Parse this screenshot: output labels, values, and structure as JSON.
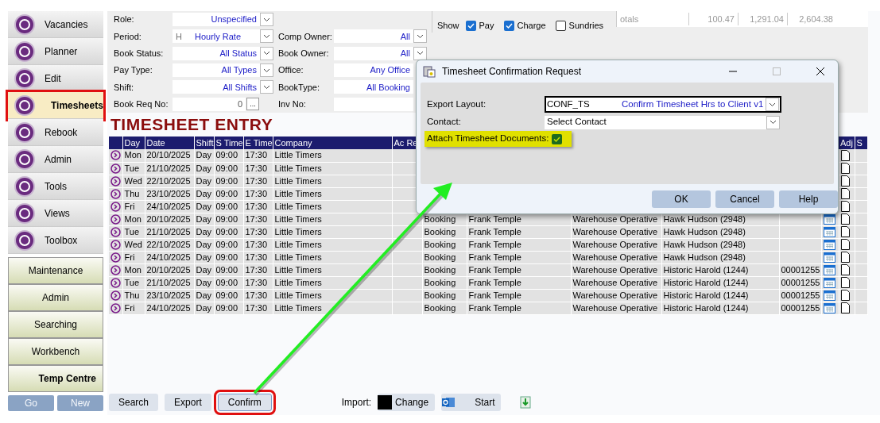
{
  "sidebar": {
    "items": [
      {
        "label": "Vacancies",
        "selected": false,
        "highlighted": false
      },
      {
        "label": "Planner",
        "selected": false,
        "highlighted": false
      },
      {
        "label": "Edit",
        "selected": false,
        "highlighted": false
      },
      {
        "label": "Timesheets",
        "selected": true,
        "highlighted": true
      },
      {
        "label": "Rebook",
        "selected": false,
        "highlighted": false
      },
      {
        "label": "Admin",
        "selected": false,
        "highlighted": false
      },
      {
        "label": "Tools",
        "selected": false,
        "highlighted": false
      },
      {
        "label": "Views",
        "selected": false,
        "highlighted": false
      },
      {
        "label": "Toolbox",
        "selected": false,
        "highlighted": false
      }
    ],
    "modules": [
      {
        "label": "Maintenance",
        "selected": false
      },
      {
        "label": "Admin",
        "selected": false
      },
      {
        "label": "Searching",
        "selected": false
      },
      {
        "label": "Workbench",
        "selected": false
      },
      {
        "label": "Temp Centre",
        "selected": true
      }
    ],
    "buttons": [
      {
        "label": "Go",
        "disabled": true
      },
      {
        "label": "New",
        "disabled": true
      }
    ]
  },
  "filters_left": [
    {
      "label": "Role:",
      "value": "Unspecified",
      "kind": "dropdown"
    },
    {
      "label": "Period:",
      "prefix": "H",
      "value": "Hourly Rate",
      "kind": "dropdown"
    },
    {
      "label": "Book Status:",
      "value": "All Status",
      "kind": "dropdown"
    },
    {
      "label": "Pay Type:",
      "value": "All Types",
      "kind": "dropdown"
    },
    {
      "label": "Shift:",
      "value": "All Shifts",
      "kind": "dropdown"
    },
    {
      "label": "Book Req No:",
      "value": "0",
      "kind": "number",
      "button": "..."
    }
  ],
  "filters_right": [
    {
      "label": "Comp Owner:",
      "value": "All",
      "kind": "dropdown"
    },
    {
      "label": "Book Owner:",
      "value": "All",
      "kind": "dropdown"
    },
    {
      "label": "Office:",
      "value": "Any Office",
      "kind": "text"
    },
    {
      "label": "BookType:",
      "value": "All Booking",
      "kind": "text"
    },
    {
      "label": "Inv No:",
      "kind": "text"
    }
  ],
  "show": {
    "label": "Show",
    "options": [
      {
        "label": "Pay",
        "checked": true
      },
      {
        "label": "Charge",
        "checked": true
      },
      {
        "label": "Sundries",
        "checked": false
      }
    ]
  },
  "totals": {
    "label": "otals",
    "values": [
      "100.47",
      "1,291.04",
      "2,604.38"
    ]
  },
  "title": "TIMESHEET ENTRY",
  "table": {
    "columns": [
      "Day",
      "Date",
      "Shift",
      "S Time",
      "E Time",
      "Company",
      "Ac Re",
      "Adj",
      "S"
    ],
    "rows": [
      {
        "day": "Mon",
        "date": "20/10/2025",
        "shift": "Day",
        "s_time": "09:00",
        "e_time": "17:30",
        "company": "Little Timers"
      },
      {
        "day": "Tue",
        "date": "21/10/2025",
        "shift": "Day",
        "s_time": "09:00",
        "e_time": "17:30",
        "company": "Little Timers"
      },
      {
        "day": "Wed",
        "date": "22/10/2025",
        "shift": "Day",
        "s_time": "09:00",
        "e_time": "17:30",
        "company": "Little Timers"
      },
      {
        "day": "Thu",
        "date": "23/10/2025",
        "shift": "Day",
        "s_time": "09:00",
        "e_time": "17:30",
        "company": "Little Timers"
      },
      {
        "day": "Fri",
        "date": "24/10/2025",
        "shift": "Day",
        "s_time": "09:00",
        "e_time": "17:30",
        "company": "Little Timers"
      },
      {
        "day": "Mon",
        "date": "20/10/2025",
        "shift": "Day",
        "s_time": "09:00",
        "e_time": "17:30",
        "company": "Little Timers",
        "type": "Booking",
        "contact": "Frank Temple",
        "role": "Warehouse Operative",
        "candidate": "Hawk Hudson (2948)"
      },
      {
        "day": "Tue",
        "date": "21/10/2025",
        "shift": "Day",
        "s_time": "09:00",
        "e_time": "17:30",
        "company": "Little Timers",
        "type": "Booking",
        "contact": "Frank Temple",
        "role": "Warehouse Operative",
        "candidate": "Hawk Hudson (2948)"
      },
      {
        "day": "Wed",
        "date": "22/10/2025",
        "shift": "Day",
        "s_time": "09:00",
        "e_time": "17:30",
        "company": "Little Timers",
        "type": "Booking",
        "contact": "Frank Temple",
        "role": "Warehouse Operative",
        "candidate": "Hawk Hudson (2948)"
      },
      {
        "day": "Fri",
        "date": "24/10/2025",
        "shift": "Day",
        "s_time": "09:00",
        "e_time": "17:30",
        "company": "Little Timers",
        "type": "Booking",
        "contact": "Frank Temple",
        "role": "Warehouse Operative",
        "candidate": "Hawk Hudson (2948)"
      },
      {
        "day": "Mon",
        "date": "20/10/2025",
        "shift": "Day",
        "s_time": "09:00",
        "e_time": "17:30",
        "company": "Little Timers",
        "type": "Booking",
        "contact": "Frank Temple",
        "role": "Warehouse Operative",
        "candidate": "Historic Harold (1244)",
        "ref": "00001255"
      },
      {
        "day": "Tue",
        "date": "21/10/2025",
        "shift": "Day",
        "s_time": "09:00",
        "e_time": "17:30",
        "company": "Little Timers",
        "type": "Booking",
        "contact": "Frank Temple",
        "role": "Warehouse Operative",
        "candidate": "Historic Harold (1244)",
        "ref": "00001255"
      },
      {
        "day": "Thu",
        "date": "23/10/2025",
        "shift": "Day",
        "s_time": "09:00",
        "e_time": "17:30",
        "company": "Little Timers",
        "type": "Booking",
        "contact": "Frank Temple",
        "role": "Warehouse Operative",
        "candidate": "Historic Harold (1244)",
        "ref": "00001255"
      },
      {
        "day": "Fri",
        "date": "24/10/2025",
        "shift": "Day",
        "s_time": "09:00",
        "e_time": "17:30",
        "company": "Little Timers",
        "type": "Booking",
        "contact": "Frank Temple",
        "role": "Warehouse Operative",
        "candidate": "Historic Harold (1244)",
        "ref": "00001255"
      }
    ]
  },
  "actions": [
    {
      "label": "Search",
      "highlighted": false
    },
    {
      "label": "Export",
      "highlighted": false
    },
    {
      "label": "Confirm",
      "highlighted": true
    }
  ],
  "import": {
    "label": "Import:",
    "buttons": [
      {
        "label": "Change",
        "kind": "swatch"
      },
      {
        "label": "Start",
        "kind": "outlook"
      }
    ]
  },
  "dialog": {
    "title": "Timesheet Confirmation Request",
    "export_layout": {
      "label": "Export Layout:",
      "code": "CONF_TS",
      "value": "Confirm Timesheet Hrs to Client v1"
    },
    "contact": {
      "label": "Contact:",
      "value": "Select Contact"
    },
    "attach": {
      "label": "Attach Timesheet Documents:",
      "checked": true,
      "highlighted": true
    },
    "buttons": [
      "OK",
      "Cancel",
      "Help"
    ]
  }
}
